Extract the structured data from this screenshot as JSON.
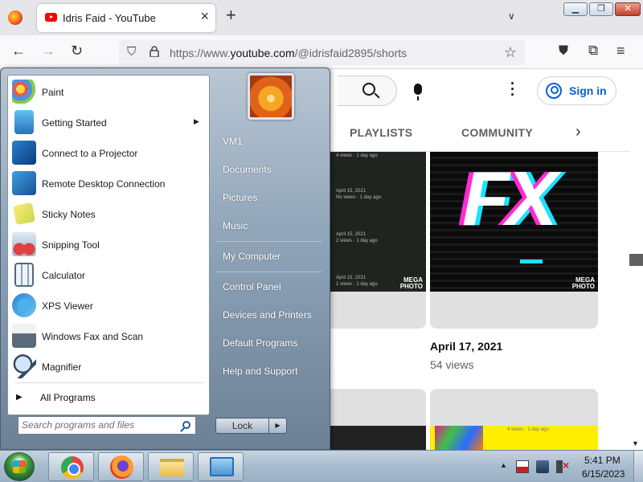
{
  "browser": {
    "tab_title": "Idris Faid - YouTube",
    "url_prefix": "https://www.",
    "url_domain": "youtube.com",
    "url_path": "/@idrisfaid2895/shorts",
    "icons": [
      "firefox-icon",
      "youtube-favicon",
      "close-icon",
      "plus-icon",
      "chevron-down-icon",
      "minimize-icon",
      "maximize-icon",
      "close-window-icon",
      "back-icon",
      "forward-icon",
      "reload-icon",
      "shield-icon",
      "lock-icon",
      "star-icon",
      "pocket-icon",
      "extensions-icon",
      "menu-icon"
    ]
  },
  "youtube": {
    "sign_in": "Sign in",
    "tabs": {
      "playlists": "PLAYLISTS",
      "community": "COMMUNITY"
    },
    "short": {
      "date": "April 17, 2021",
      "views": "54 views"
    },
    "thumb_rows": [
      "April 15, 2021",
      "No views · 1 day ago",
      "April 15, 2021",
      "2 views · 1 day ago",
      "April 15, 2021",
      "1 views · 1 day ago"
    ],
    "watermark": "MEGA PHOTO",
    "fx_text": "FX",
    "card4_meta": "4 views · 1 day ago"
  },
  "start_menu": {
    "programs": [
      {
        "label": "Paint"
      },
      {
        "label": "Getting Started",
        "has_submenu": true
      },
      {
        "label": "Connect to a Projector"
      },
      {
        "label": "Remote Desktop Connection"
      },
      {
        "label": "Sticky Notes"
      },
      {
        "label": "Snipping Tool"
      },
      {
        "label": "Calculator"
      },
      {
        "label": "XPS Viewer"
      },
      {
        "label": "Windows Fax and Scan"
      },
      {
        "label": "Magnifier"
      }
    ],
    "all_programs": "All Programs",
    "search_placeholder": "Search programs and files",
    "places": {
      "user": "VM1",
      "documents": "Documents",
      "pictures": "Pictures",
      "music": "Music",
      "computer": "My Computer",
      "control_panel": "Control Panel",
      "devices": "Devices and Printers",
      "defaults": "Default Programs",
      "help": "Help and Support"
    },
    "lock": "Lock"
  },
  "taskbar": {
    "apps": [
      "chrome-icon",
      "firefox-icon",
      "explorer-icon",
      "remote-desktop-icon"
    ],
    "time": "5:41 PM",
    "date": "6/15/2023"
  }
}
